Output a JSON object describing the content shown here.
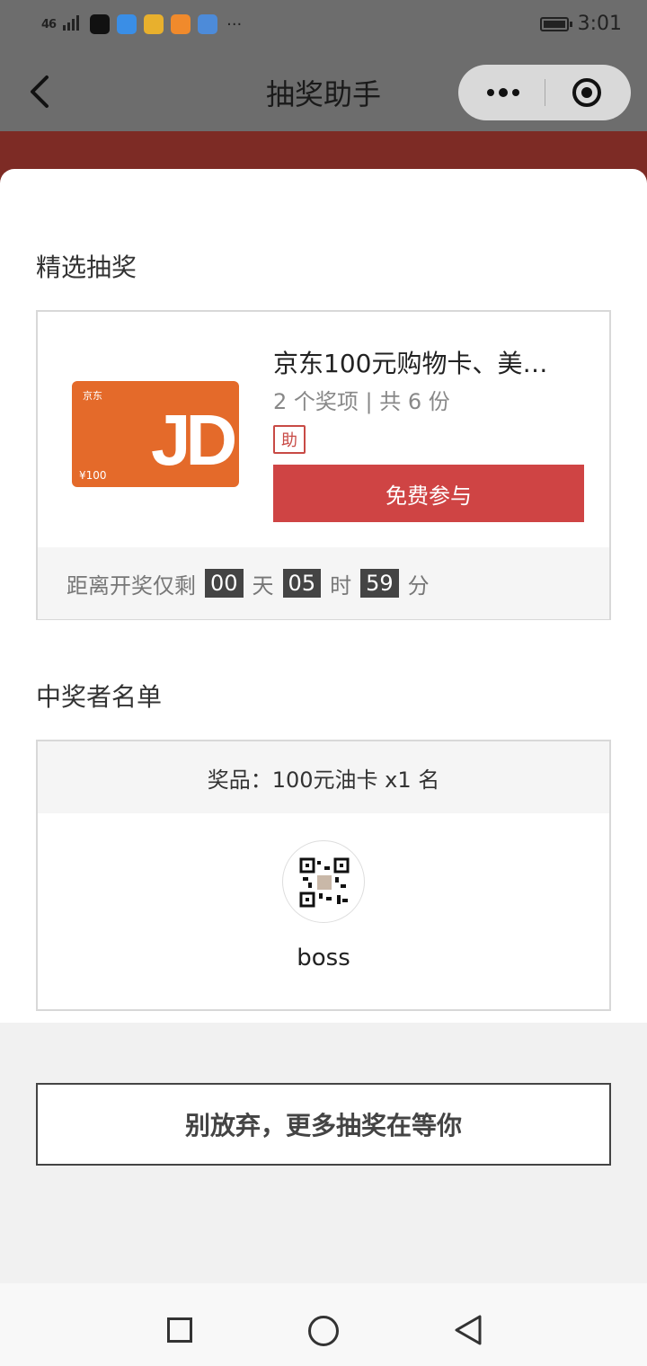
{
  "status_bar": {
    "signal": "46",
    "more_dots": "···",
    "time": "3:01"
  },
  "nav": {
    "title": "抽奖助手",
    "more_icon": "more-dots-icon",
    "close_icon": "target-circle-icon"
  },
  "featured": {
    "section_title": "精选抽奖",
    "card_image": {
      "brand": "京东",
      "letters": "JD",
      "value": "¥100"
    },
    "prize_name": "京东100元购物卡、美…",
    "prize_meta": "2 个奖项 | 共 6 份",
    "help_tag": "助",
    "join_button": "免费参与",
    "countdown": {
      "prefix": "距离开奖仅剩",
      "days": "00",
      "days_unit": "天",
      "hours": "05",
      "hours_unit": "时",
      "minutes": "59",
      "minutes_unit": "分"
    }
  },
  "winners": {
    "section_title": "中奖者名单",
    "prize_line": "奖品：100元油卡 x1 名",
    "winner_name": "boss"
  },
  "more_button": "别放弃，更多抽奖在等你",
  "colors": {
    "accent_red": "#cf4444",
    "header_gray": "#6d6d6d",
    "band_red": "#7d2b25",
    "jd_orange": "#e46a2a"
  }
}
